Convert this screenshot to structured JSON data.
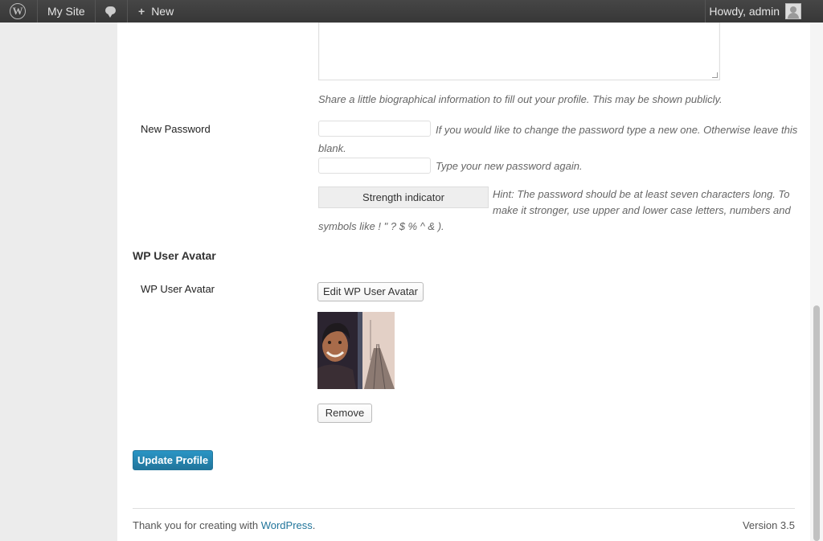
{
  "admin_bar": {
    "site_name": "My Site",
    "new_label": "New",
    "howdy": "Howdy, admin"
  },
  "profile": {
    "bio_description": "Share a little biographical information to fill out your profile. This may be shown publicly.",
    "new_password_label": "New Password",
    "password_hint_1a": "If you would like to change the password type a new one. Otherwise leave this",
    "password_hint_1b": "blank.",
    "password_hint_2": "Type your new password again.",
    "strength_indicator": "Strength indicator",
    "strength_hint_a": "Hint: The password should be at least seven characters long. To",
    "strength_hint_b": "make it stronger, use upper and lower case letters, numbers and",
    "strength_hint_c": "symbols like ! \" ? $ % ^ & )."
  },
  "avatar_section": {
    "title": "WP User Avatar",
    "label": "WP User Avatar",
    "edit_button": "Edit WP User Avatar",
    "remove_button": "Remove"
  },
  "actions": {
    "update_profile": "Update Profile"
  },
  "footer": {
    "thanks_prefix": "Thank you for creating with ",
    "wordpress_link": "WordPress",
    "thanks_suffix": ".",
    "version": "Version 3.5"
  },
  "colors": {
    "admin_bar": "#464646",
    "primary_button": "#21759b",
    "link": "#21759b"
  }
}
